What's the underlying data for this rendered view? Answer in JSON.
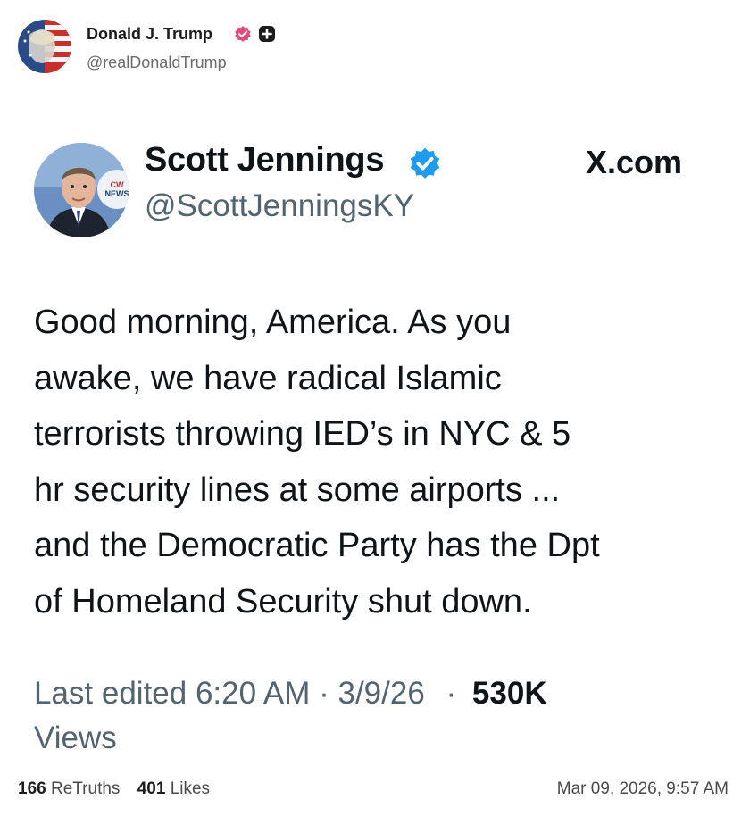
{
  "poster": {
    "name": "Donald J. Trump",
    "handle": "@realDonaldTrump"
  },
  "embedded_tweet": {
    "name": "Scott Jennings",
    "handle": "@ScottJenningsKY",
    "source": "X.com",
    "body_lines": [
      "Good morning, America. As you",
      "awake, we have radical Islamic",
      "terrorists throwing IED’s in NYC & 5",
      "hr security lines at some airports ...",
      "and the Democratic Party has the Dpt",
      "of Homeland Security shut down."
    ],
    "edited_text": "Last edited 6:20 AM · 3/9/26",
    "separator": "·",
    "views_count": "530K",
    "views_label": "Views"
  },
  "footer": {
    "retruths_count": "166",
    "retruths_label": "ReTruths",
    "likes_count": "401",
    "likes_label": "Likes",
    "timestamp": "Mar 09, 2026, 9:57 AM"
  },
  "colors": {
    "verified_pink": "#e24a78",
    "verified_blue": "#1d9bf0",
    "text_primary": "#0f1419",
    "text_secondary": "#536471"
  },
  "icons": {
    "poster_verified": "verified-badge-icon",
    "poster_plus": "plus-badge-icon",
    "tweet_verified": "verified-check-icon"
  }
}
